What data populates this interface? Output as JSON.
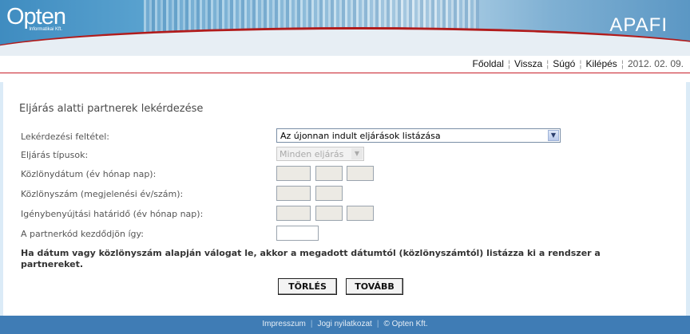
{
  "header": {
    "logo_text": "Opten",
    "logo_sub": "Informatikai Kft.",
    "app_title": "APAFI"
  },
  "topnav": {
    "home": "Főoldal",
    "back": "Vissza",
    "help": "Súgó",
    "logout": "Kilépés",
    "date": "2012. 02. 09."
  },
  "form": {
    "title": "Eljárás alatti partnerek lekérdezése",
    "labels": {
      "query_condition": "Lekérdezési feltétel:",
      "procedure_types": "Eljárás típusok:",
      "gazette_date": "Közlönydátum (év hónap nap):",
      "gazette_number": "Közlönyszám (megjelenési év/szám):",
      "claim_deadline": "Igénybenyújtási határidő (év hónap nap):",
      "partner_code": "A partnerkód kezdődjön így:"
    },
    "query_condition_value": "Az újonnan indult eljárások listázása",
    "procedure_type_value": "Minden eljárás",
    "note": "Ha dátum vagy közlönyszám alapján válogat le, akkor a megadott dátumtól (közlönyszámtól) listázza ki a rendszer a partnereket.",
    "clear_button": "TÖRLÉS",
    "next_button": "TOVÁBB"
  },
  "footer": {
    "impressum": "Impresszum",
    "legal": "Jogi nyilatkozat",
    "copyright": "© Opten Kft."
  }
}
